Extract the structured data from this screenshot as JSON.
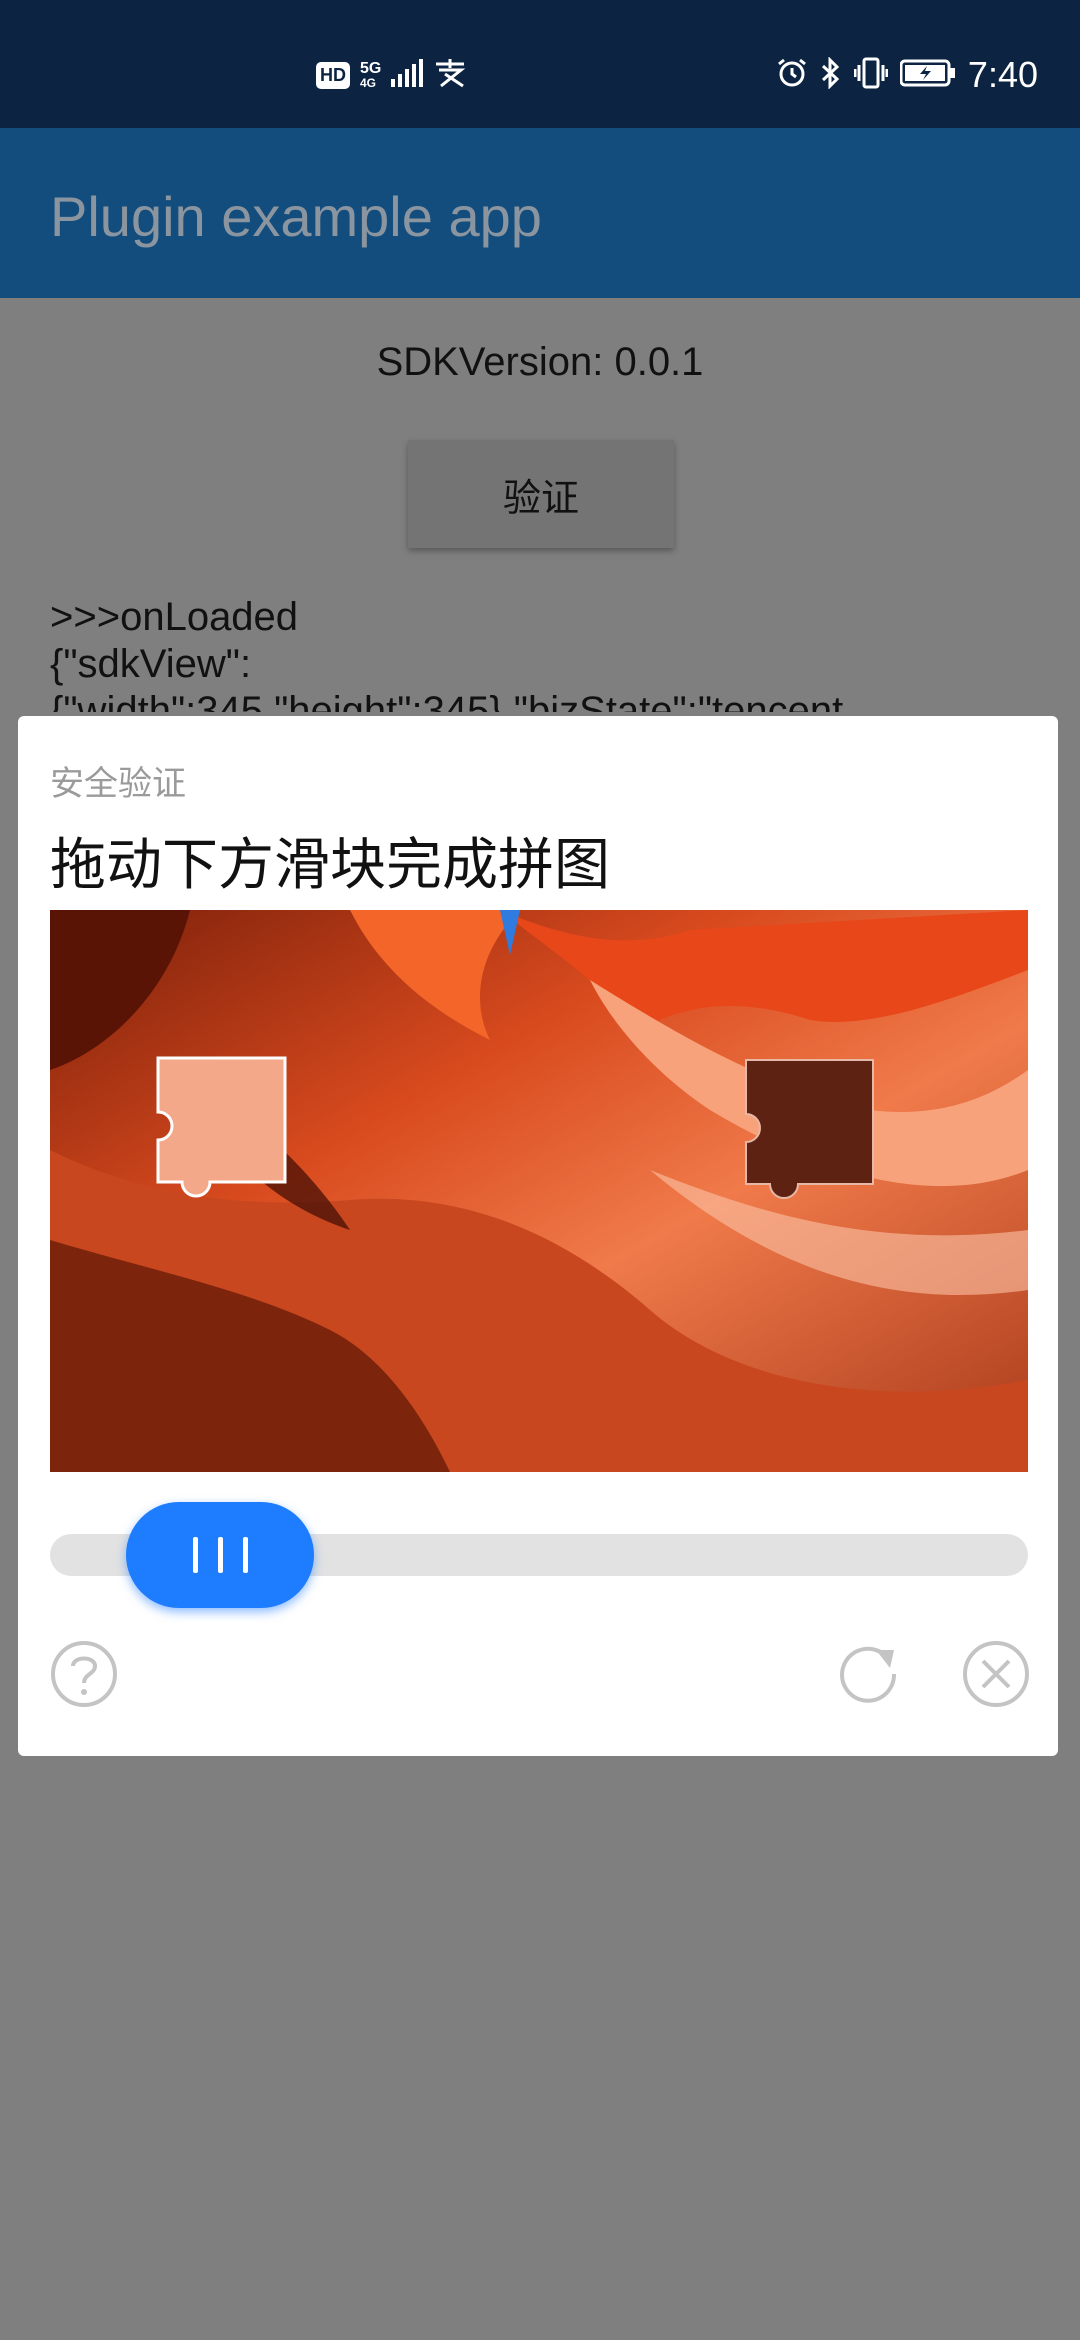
{
  "status_bar": {
    "hd": "HD",
    "network": "5G",
    "network_sub": "4G",
    "time": "7:40",
    "icons": [
      "hd-icon",
      "signal-icon",
      "alipay-icon",
      "alarm-icon",
      "bluetooth-icon",
      "vibrate-icon",
      "battery-charging-icon"
    ]
  },
  "app_bar": {
    "title": "Plugin example app"
  },
  "main": {
    "sdk_version": "SDKVersion: 0.0.1",
    "verify_button": "验证",
    "log_text": ">>>onLoaded\n{\"sdkView\":\n{\"width\":345,\"height\":345},\"bizState\":\"tencent"
  },
  "captcha": {
    "subtitle": "安全验证",
    "instruction": "拖动下方滑块完成拼图",
    "slider_progress": 0.12,
    "icons": [
      "help-icon",
      "refresh-icon",
      "close-icon"
    ],
    "colors": {
      "accent": "#1e7cff",
      "track": "#e2e2e2"
    }
  }
}
